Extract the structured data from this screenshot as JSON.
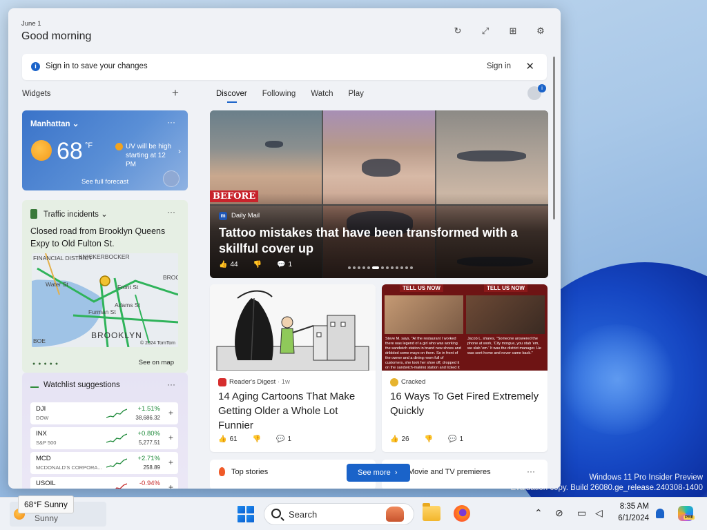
{
  "header": {
    "date": "June 1",
    "greeting": "Good morning",
    "icons": [
      "refresh-icon",
      "expand-icon",
      "pin-icon",
      "settings-icon"
    ]
  },
  "signin": {
    "text": "Sign in to save your changes",
    "link": "Sign in",
    "close": "✕"
  },
  "widgets": {
    "label": "Widgets",
    "add": "+",
    "weather": {
      "location": "Manhattan",
      "temp": "68",
      "unit": "°F",
      "uv": "UV will be high starting at 12 PM",
      "forecast_link": "See full forecast",
      "more": "···"
    },
    "traffic": {
      "title": "Traffic incidents",
      "body": "Closed road from Brooklyn Queens Expy to Old Fulton St.",
      "map_labels": [
        "FINANCIAL DISTRICT",
        "KNICKERBOCKER",
        "Water St",
        "Front St",
        "Furman St",
        "Adams St",
        "BROOKLYN",
        "BROO",
        "BOE",
        "© 2024 TomTom"
      ],
      "see_on_map": "See on map",
      "more": "···"
    },
    "watchlist": {
      "title": "Watchlist suggestions",
      "more": "···",
      "stocks": [
        {
          "symbol": "DJI",
          "name": "DOW",
          "change": "+1.51%",
          "value": "38,686.32",
          "direction": "up"
        },
        {
          "symbol": "INX",
          "name": "S&P 500",
          "change": "+0.80%",
          "value": "5,277.51",
          "direction": "up"
        },
        {
          "symbol": "MCD",
          "name": "MCDONALD'S CORPORA...",
          "change": "+2.71%",
          "value": "258.89",
          "direction": "up"
        },
        {
          "symbol": "USOIL",
          "name": "",
          "change": "-0.94%",
          "value": "",
          "direction": "down"
        }
      ]
    }
  },
  "feed": {
    "tabs": [
      "Discover",
      "Following",
      "Watch",
      "Play"
    ],
    "active_tab": "Discover",
    "hero": {
      "tag": "BEFORE",
      "source": "Daily Mail",
      "title": "Tattoo mistakes that have been transformed with a skillful cover up",
      "likes": "44",
      "comments": "1"
    },
    "cards": [
      {
        "source": "Reader's Digest",
        "age": "· 1w",
        "title": "14 Aging Cartoons That Make Getting Older a Whole Lot Funnier",
        "likes": "61",
        "comments": "1"
      },
      {
        "source": "Cracked",
        "age": "",
        "title": "16 Ways To Get Fired Extremely Quickly",
        "likes": "26",
        "comments": "1"
      }
    ],
    "cracked_panels": [
      {
        "label": "TELL US NOW",
        "quote": "Steve M. says, \"At the restaurant I worked there was legend of a girl who was working the sandwich station in brand new shoes and dribbled some mayo on them. So in front of the owner and a dining room full of customers, she took her shoe off, dropped it on the sandwich-making station and licked it clean. It was his last day.\""
      },
      {
        "label": "TELL US NOW",
        "quote": "Jacob L. shares, \"Someone answered the phone at work, 'City morgue, you stab 'em, we slab 'em.' It was the district manager. He was sent home and never came back.\""
      }
    ],
    "strips": {
      "top_stories": "Top stories",
      "see_more": "See more",
      "movies": "Movie and TV premieres",
      "more": "···"
    }
  },
  "desktop": {
    "watermark_line1": "Windows 11 Pro Insider Preview",
    "watermark_line2": "Evaluation copy. Build 26080.ge_release.240308-1400"
  },
  "taskbar": {
    "weather_tooltip": "68°F Sunny",
    "weather_text": "Sunny",
    "search_placeholder": "Search",
    "time": "8:35 AM",
    "date": "6/1/2024",
    "copilot_badge": "PRE"
  },
  "colors": {
    "accent": "#1a63c9",
    "positive": "#1e8a3a",
    "negative": "#c62828"
  }
}
